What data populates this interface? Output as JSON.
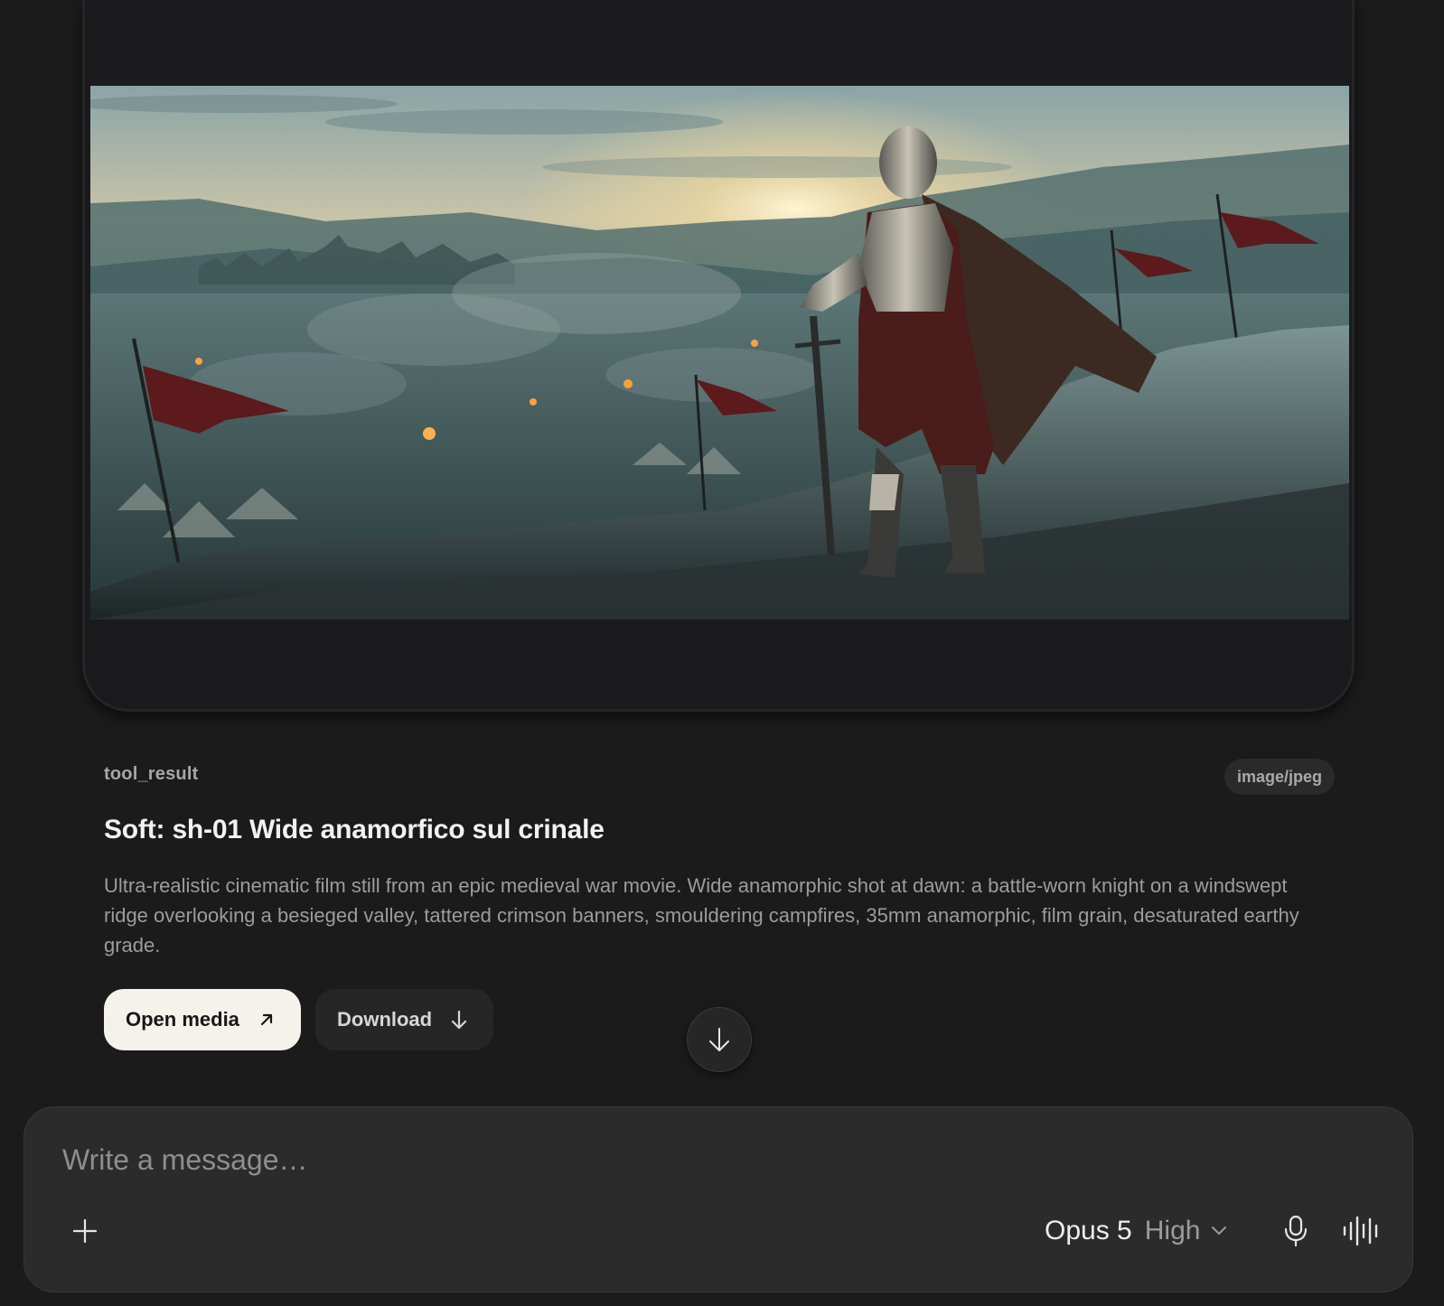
{
  "media": {
    "image_alt": "Knight on a ridge overlooking a besieged valley at dawn",
    "tool_label": "tool_result",
    "mime_type": "image/jpeg",
    "title": "Soft: sh-01 Wide anamorfico sul crinale",
    "description": "Ultra-realistic cinematic film still from an epic medieval war movie. Wide anamorphic shot at dawn: a battle-worn knight on a windswept ridge overlooking a besieged valley, tattered crimson banners, smouldering campfires, 35mm anamorphic, film grain, desaturated earthy grade."
  },
  "actions": {
    "open_label": "Open media",
    "open_icon": "arrow-up-right-icon",
    "download_label": "Download",
    "download_icon": "arrow-down-icon",
    "scroll_icon": "arrow-down-icon"
  },
  "composer": {
    "placeholder": "Write a message…",
    "value": "",
    "add_icon": "plus-icon",
    "model_name": "Opus 5",
    "model_effort": "High",
    "chevron_icon": "chevron-down-icon",
    "mic_icon": "microphone-icon",
    "voice_icon": "voice-waveform-icon"
  },
  "colors": {
    "background": "#1b1b1b",
    "composer_bg": "#2b2b2b",
    "primary_button_bg": "#f5f2ec",
    "secondary_button_bg": "#262626",
    "banner_crimson": "#6a1c1c"
  }
}
